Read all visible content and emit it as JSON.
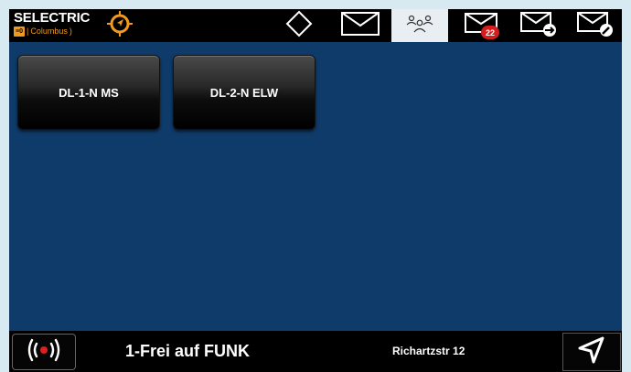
{
  "brand": {
    "name": "SELECTRIC",
    "badge": "≡0",
    "product": "Columbus"
  },
  "tabs": {
    "diamond": "diamond-icon",
    "messages": "envelope-icon",
    "units": "people-icon",
    "inbox": "envelope-inbox-icon",
    "inbox_count": "22",
    "outbox": "envelope-send-icon",
    "compose": "envelope-edit-icon",
    "active": "units"
  },
  "units": [
    {
      "label": "DL-1-N MS"
    },
    {
      "label": "DL-2-N ELW"
    }
  ],
  "statusbar": {
    "signal_icon": "radio-signal-icon",
    "status": "1-Frei auf FUNK",
    "address": "Richartzstr 12",
    "nav_icon": "navigation-arrow-icon"
  },
  "colors": {
    "background": "#0f3b6b",
    "accent": "#f29a1e",
    "badge_red": "#d41d1d",
    "active_tab": "#e9eef3"
  }
}
